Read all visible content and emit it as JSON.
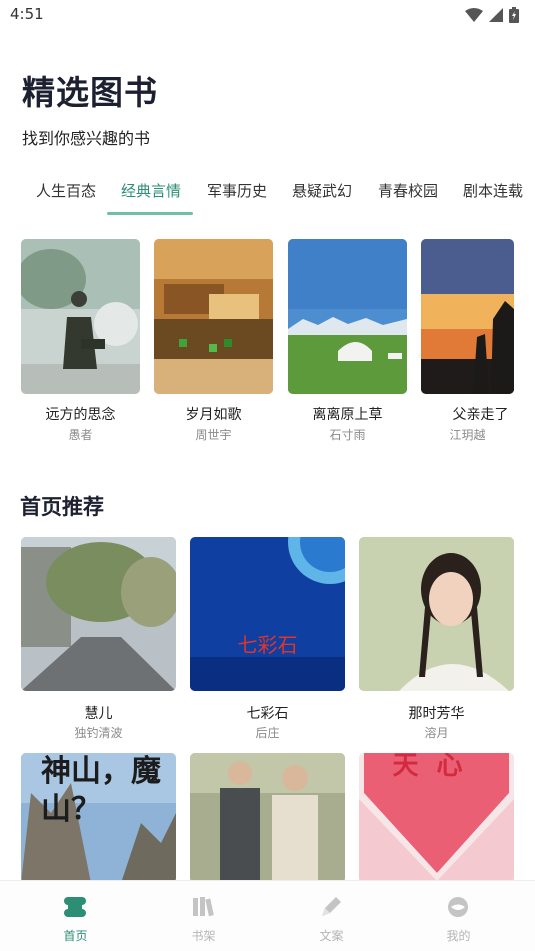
{
  "status_bar": {
    "time": "4:51"
  },
  "header": {
    "title": "精选图书",
    "subtitle": "找到你感兴趣的书"
  },
  "tabs": [
    {
      "label": "人生百态"
    },
    {
      "label": "经典言情",
      "active": true
    },
    {
      "label": "军事历史"
    },
    {
      "label": "悬疑武幻"
    },
    {
      "label": "青春校园"
    },
    {
      "label": "剧本连载"
    }
  ],
  "featured_books": [
    {
      "title": "远方的思念",
      "author": "愚者"
    },
    {
      "title": "岁月如歌",
      "author": "周世宇"
    },
    {
      "title": "离离原上草",
      "author": "石寸雨"
    },
    {
      "title": "父亲走了",
      "author": "江玥越"
    }
  ],
  "recommend": {
    "title": "首页推荐",
    "books": [
      {
        "title": "慧儿",
        "author": "独钓清波"
      },
      {
        "title": "七彩石",
        "author": "后庄",
        "cover_text": "七彩石"
      },
      {
        "title": "那时芳华",
        "author": "溶月"
      },
      {
        "cover_text": "神山，魔山？"
      },
      {},
      {
        "cover_text": "天心"
      }
    ]
  },
  "bottom_nav": [
    {
      "label": "首页",
      "icon": "home-icon",
      "active": true
    },
    {
      "label": "书架",
      "icon": "bookshelf-icon"
    },
    {
      "label": "文案",
      "icon": "pen-icon"
    },
    {
      "label": "我的",
      "icon": "profile-icon"
    }
  ],
  "colors": {
    "accent": "#2d8e76",
    "indicator": "#6fbfa9",
    "title": "#1d2030",
    "muted": "#8a8a8a",
    "nav_inactive": "#b5b5b5"
  }
}
